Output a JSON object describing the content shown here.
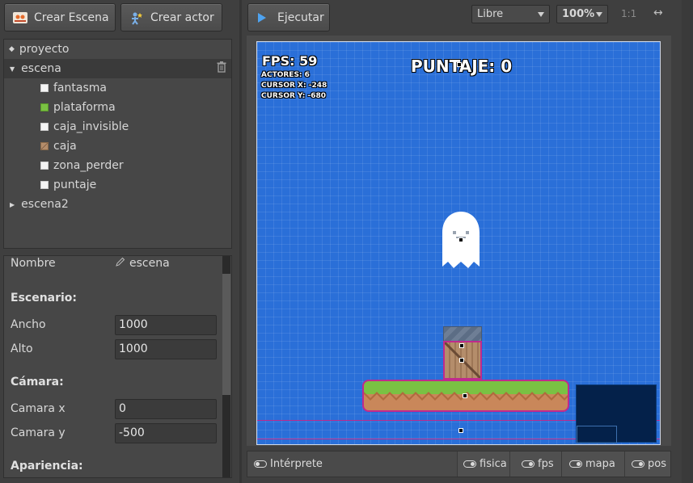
{
  "toolbar": {
    "crear_escena": "Crear Escena",
    "crear_actor": "Crear actor",
    "ejecutar": "Ejecutar",
    "modo": "Libre",
    "zoom": "100%",
    "zoom_reset": "1:1"
  },
  "tree": {
    "proyecto": "proyecto",
    "escena": "escena",
    "actores": [
      "fantasma",
      "plataforma",
      "caja_invisible",
      "caja",
      "zona_perder",
      "puntaje"
    ],
    "escena2": "escena2"
  },
  "props": {
    "nombre_label": "Nombre",
    "nombre_value": "escena",
    "escenario_head": "Escenario:",
    "ancho_label": "Ancho",
    "ancho_value": "1000",
    "alto_label": "Alto",
    "alto_value": "1000",
    "camara_head": "Cámara:",
    "camara_x_label": "Camara x",
    "camara_x_value": "0",
    "camara_y_label": "Camara y",
    "camara_y_value": "-500",
    "apariencia_head": "Apariencia:"
  },
  "canvas": {
    "fps": "FPS: 59",
    "actores": "ACTORES: 6",
    "cursor_x": "CURSOR X: -248",
    "cursor_y": "CURSOR Y: -680",
    "puntaje": "PUNTAJE: 0"
  },
  "bottom": {
    "interprete": "Intérprete",
    "fisica": "fisica",
    "fps": "fps",
    "mapa": "mapa",
    "pos": "pos"
  },
  "colors": {
    "canvas_bg": "#2a6fd8",
    "selection": "#c02a8d",
    "grass": "#7ac143"
  }
}
